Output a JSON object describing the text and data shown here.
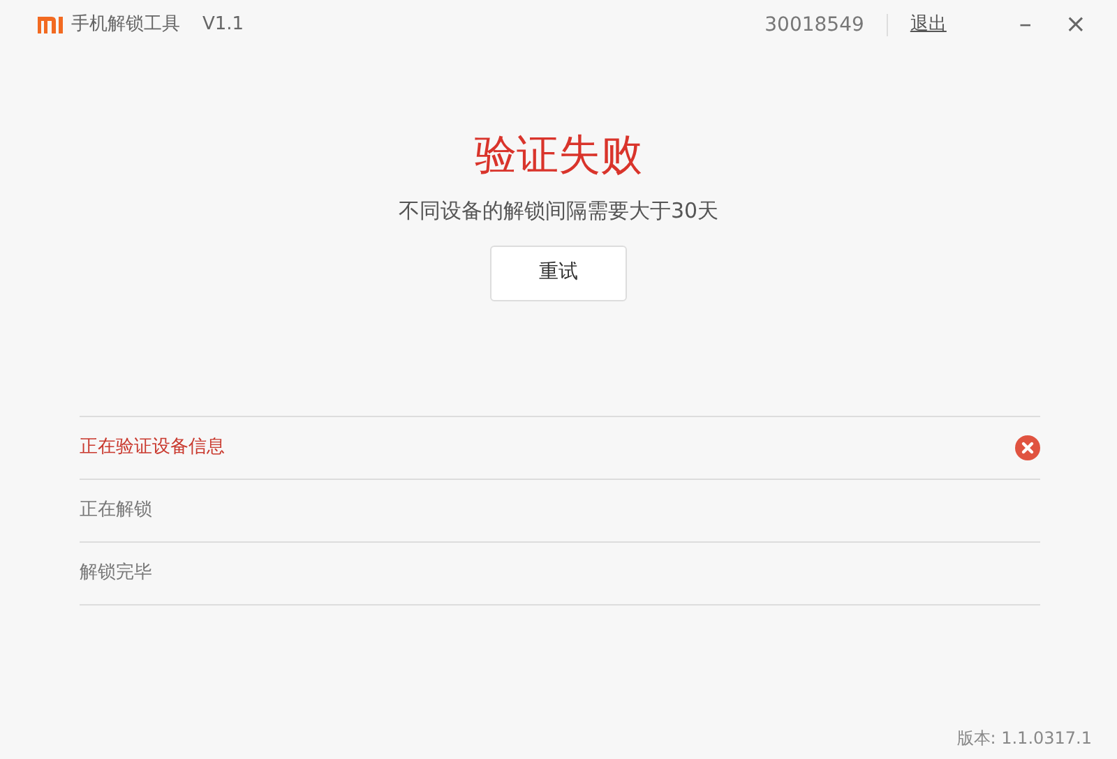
{
  "window": {
    "title": "手机解锁工具",
    "version": "V1.1",
    "account": "30018549",
    "logout": "退出",
    "minimize": "–",
    "close": "×"
  },
  "result": {
    "heading": "验证失败",
    "message": "不同设备的解锁间隔需要大于30天",
    "button": "重试"
  },
  "steps": [
    {
      "label": "正在验证设备信息",
      "failed": true
    },
    {
      "label": "正在解锁",
      "failed": false
    },
    {
      "label": "解锁完毕",
      "failed": false
    }
  ],
  "footer": {
    "version": "版本: 1.1.0317.1"
  }
}
